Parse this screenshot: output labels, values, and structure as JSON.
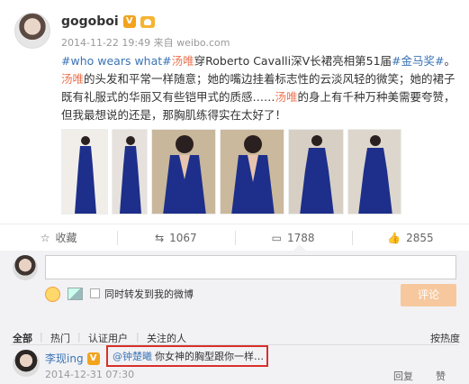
{
  "author": {
    "name": "gogoboi",
    "v_badge": "V"
  },
  "meta": {
    "time": "2014-11-22 19:49",
    "from_label": "来自",
    "source": "weibo.com"
  },
  "post": {
    "tag1": "#who wears what#",
    "name1": "汤唯",
    "t1": "穿Roberto Cavalli深V长裙亮相第51届",
    "tag2": "#金马奖#",
    "t2": "。",
    "name2": "汤唯",
    "t3": "的头发和平常一样随意；她的嘴边挂着标志性的云淡风轻的微笑；她的裙子既有礼服式的华丽又有些铠甲式的质感……",
    "name3": "汤唯",
    "t4": "的身上有千种万种美需要夸赞，但我最想说的还是，那胸肌练得实在太好了！"
  },
  "actions": {
    "favorite": "收藏",
    "repost": "1067",
    "comments": "1788",
    "likes": "2855"
  },
  "composer": {
    "repost_label": "同时转发到我的微博",
    "submit_label": "评论"
  },
  "filters": {
    "all": "全部",
    "hot": "热门",
    "verified": "认证用户",
    "following": "关注的人",
    "sort": "按热度"
  },
  "comment": {
    "user": "李现ing",
    "mention": "@钟楚曦",
    "text": "你女神的胸型跟你一样…",
    "time": "2014-12-31 07:30",
    "reply": "回复",
    "like": "赞"
  },
  "colors": {
    "accent": "#eb7350",
    "link": "#3a73b4",
    "dress": "#1d2f8a"
  }
}
